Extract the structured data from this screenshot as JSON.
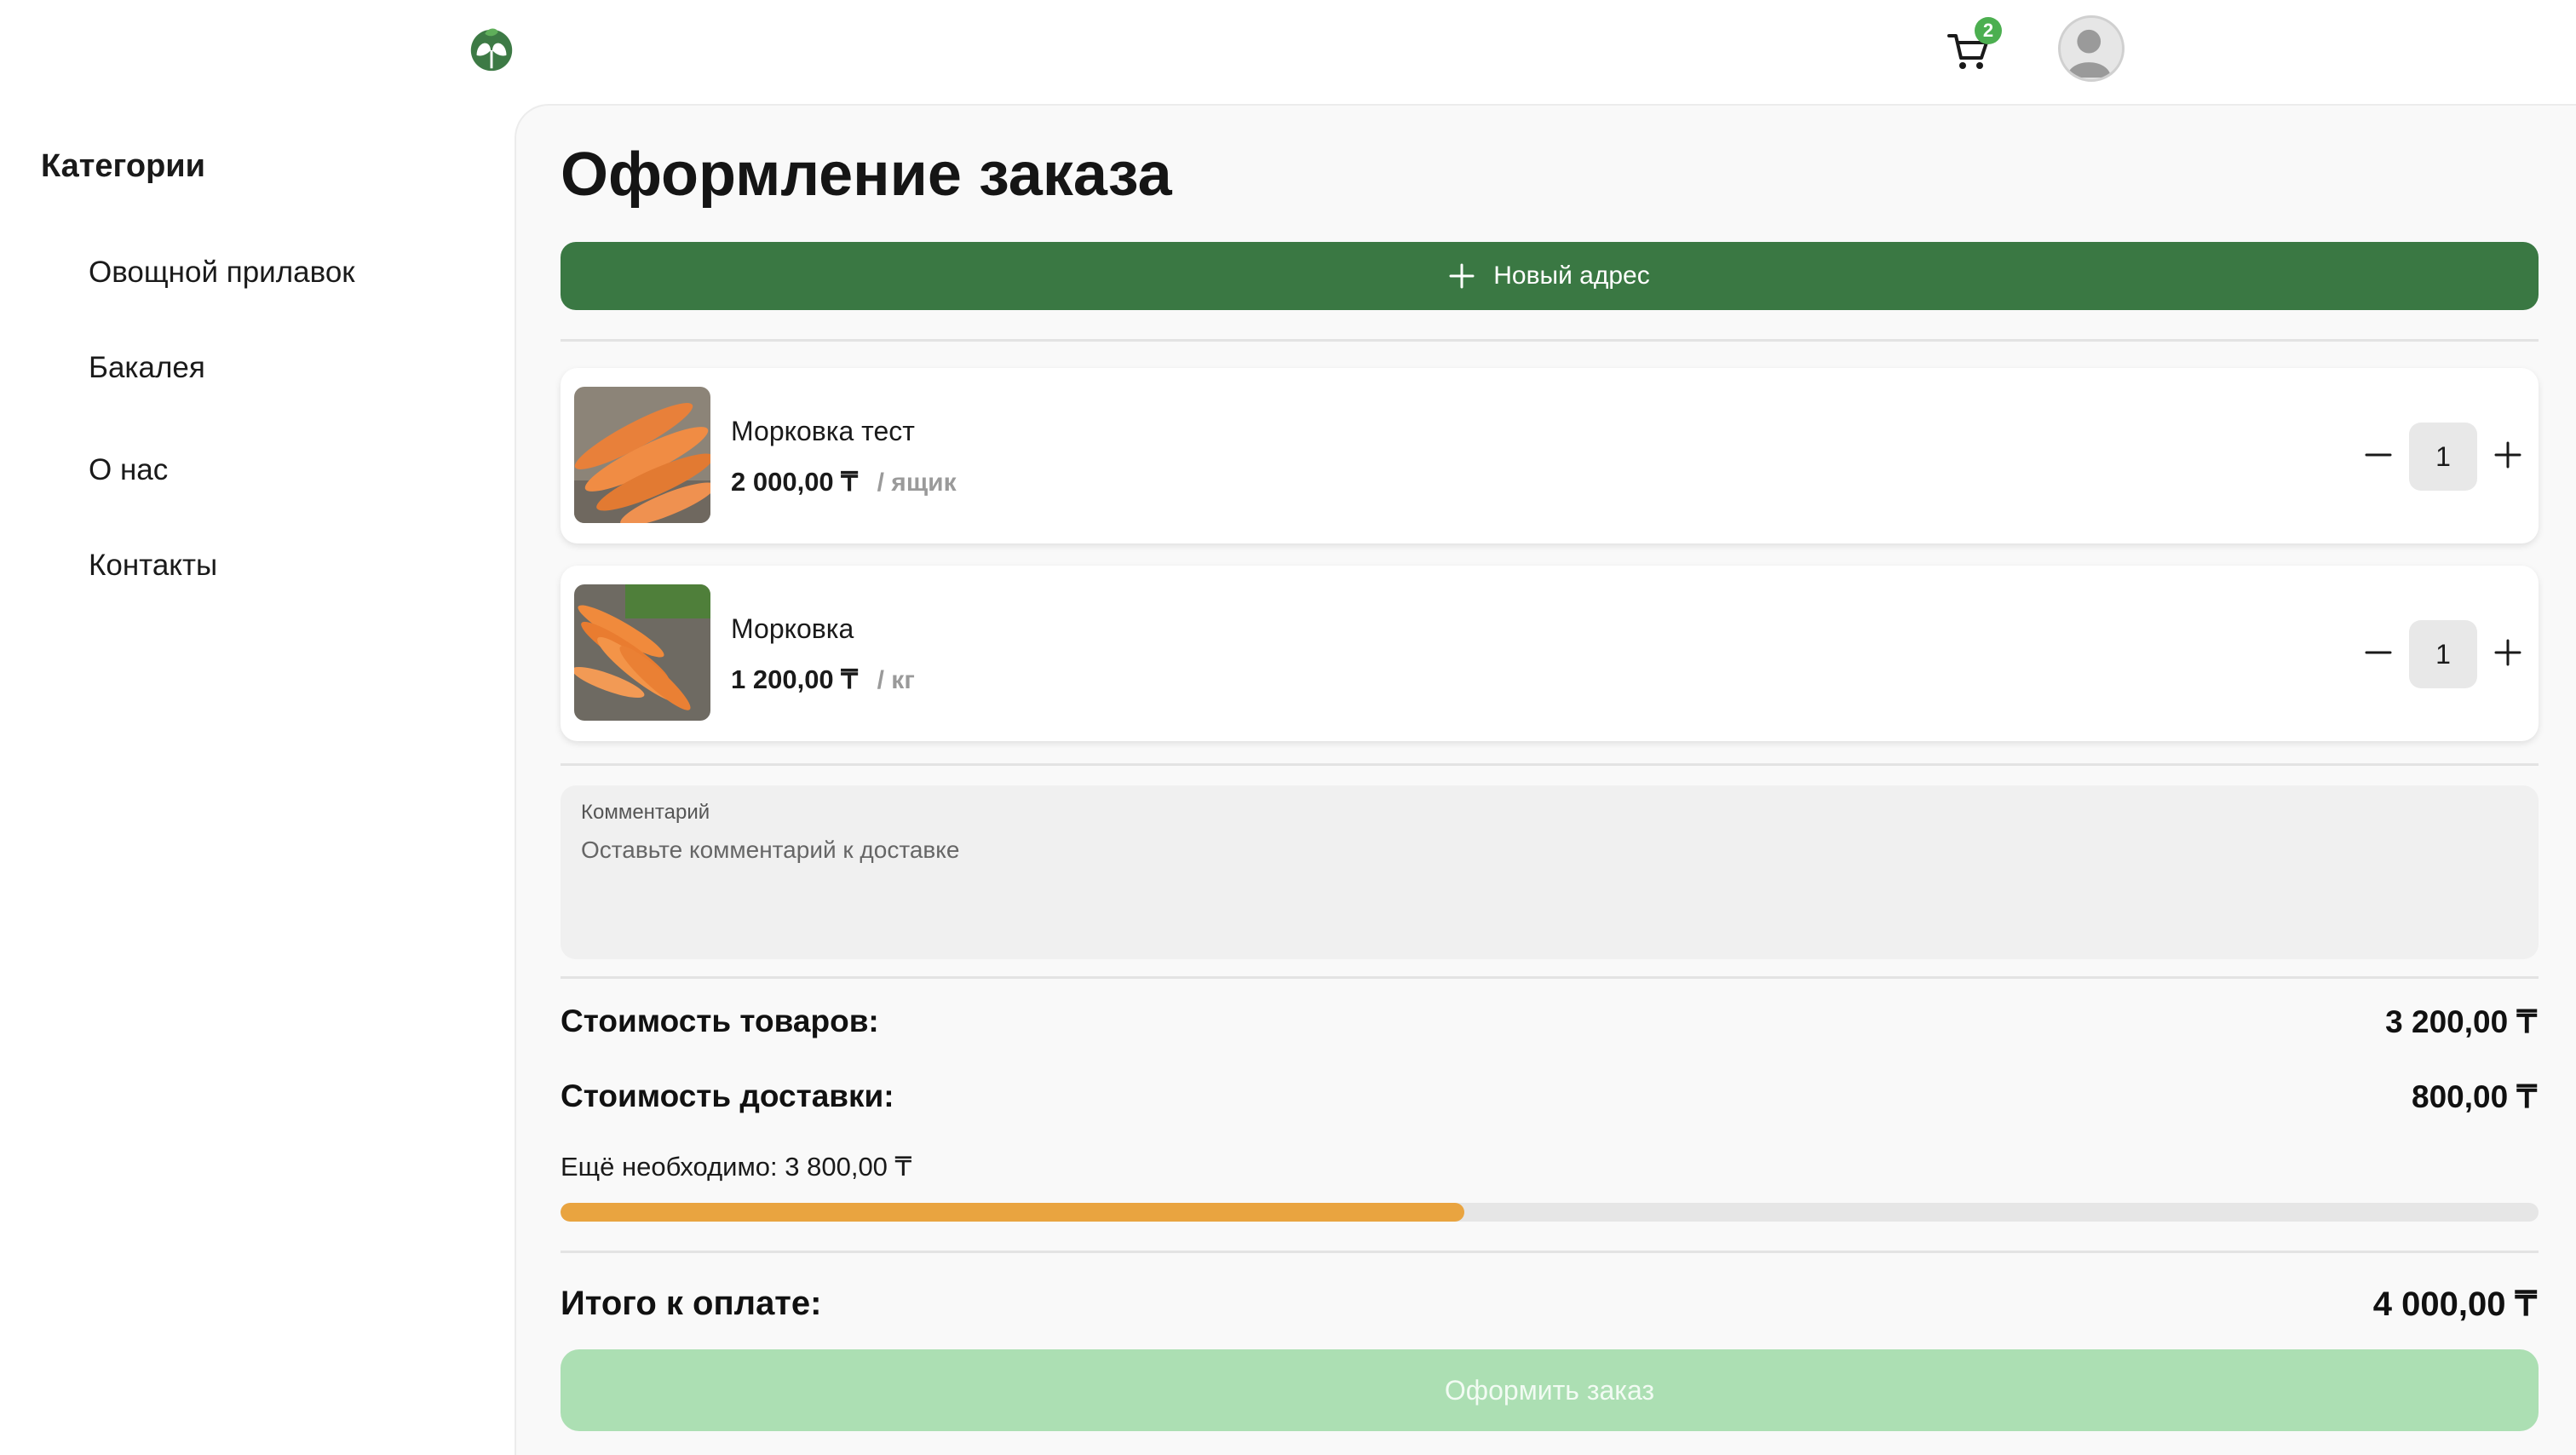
{
  "header": {
    "cart_count": "2",
    "logo_icon": "leaf-logo-icon",
    "cart_icon": "cart-icon",
    "avatar_icon": "user-avatar-icon"
  },
  "sidebar": {
    "title": "Категории",
    "items": [
      {
        "label": "Овощной прилавок"
      },
      {
        "label": "Бакалея"
      },
      {
        "label": "О нас"
      },
      {
        "label": "Контакты"
      }
    ]
  },
  "main": {
    "title": "Оформление заказа",
    "new_address_label": "Новый адрес",
    "products": [
      {
        "name": "Морковка тест",
        "price": "2 000,00 ₸",
        "unit": "/ ящик",
        "quantity": "1"
      },
      {
        "name": "Морковка",
        "price": "1 200,00 ₸",
        "unit": "/ кг",
        "quantity": "1"
      }
    ],
    "comment": {
      "label": "Комментарий",
      "placeholder": "Оставьте комментарий к доставке"
    },
    "summary": {
      "goods_label": "Стоимость товаров:",
      "goods_value": "3 200,00 ₸",
      "delivery_label": "Стоимость доставки:",
      "delivery_value": "800,00 ₸",
      "needed_text": "Ещё необходимо: 3 800,00 ₸",
      "progress_fraction": 0.457,
      "total_label": "Итого к оплате:",
      "total_value": "4 000,00 ₸"
    },
    "submit_label": "Оформить заказ"
  },
  "colors": {
    "brand_green": "#3a7843",
    "badge_green": "#4caf50",
    "progress_orange": "#e9a440",
    "submit_disabled_green": "#acdfb3"
  }
}
